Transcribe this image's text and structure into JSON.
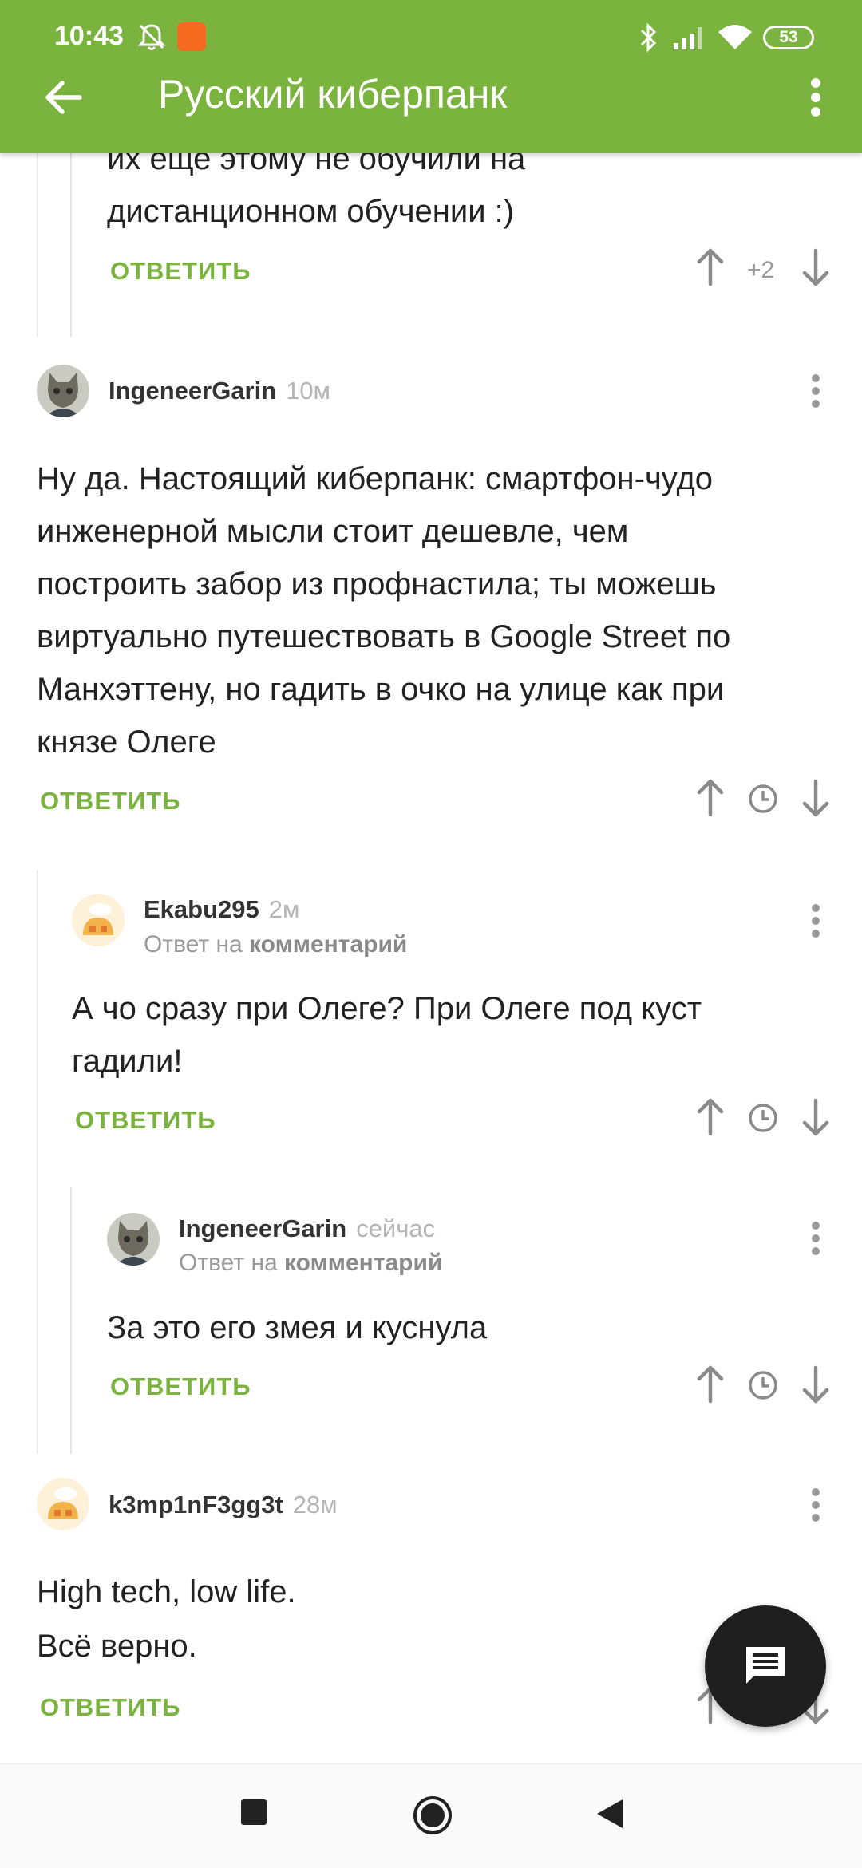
{
  "status_bar": {
    "time": "10:43",
    "battery": "53"
  },
  "app_bar": {
    "title": "Русский киберпанк"
  },
  "reply_label": "ОТВЕТИТЬ",
  "comments": [
    {
      "text_lines": [
        "их еще этому не обучили на",
        "дистанционном обучении :)"
      ],
      "score": "+2"
    },
    {
      "author": "IngeneerGarin",
      "time": "10м",
      "text_lines": [
        "Ну да. Настоящий киберпанк: смартфон-чудо",
        "инженерной мысли стоит дешевле, чем",
        "построить забор из профнастила; ты можешь",
        "виртуально путешествовать в Google Street по",
        "Манхэттену, но гадить в очко на улице как при",
        "князе Олеге"
      ]
    },
    {
      "author": "Ekabu295",
      "time": "2м",
      "reply_to_prefix": "Ответ на",
      "reply_to_target": "комментарий",
      "text_lines": [
        "А чо сразу при Олеге? При Олеге под куст",
        "гадили!"
      ]
    },
    {
      "author": "IngeneerGarin",
      "time": "сейчас",
      "reply_to_prefix": "Ответ на",
      "reply_to_target": "комментарий",
      "text_lines": [
        "За это его змея и куснула"
      ]
    },
    {
      "author": "k3mp1nF3gg3t",
      "time": "28м",
      "text_lines": [
        "High tech, low life.",
        "Всё верно."
      ]
    }
  ],
  "colors": {
    "accent": "#7ab33e",
    "fab": "#1f1f1f"
  },
  "icons": [
    "back-arrow-icon",
    "more-vert-icon",
    "upvote-icon",
    "downvote-icon",
    "clock-icon",
    "chat-icon"
  ]
}
